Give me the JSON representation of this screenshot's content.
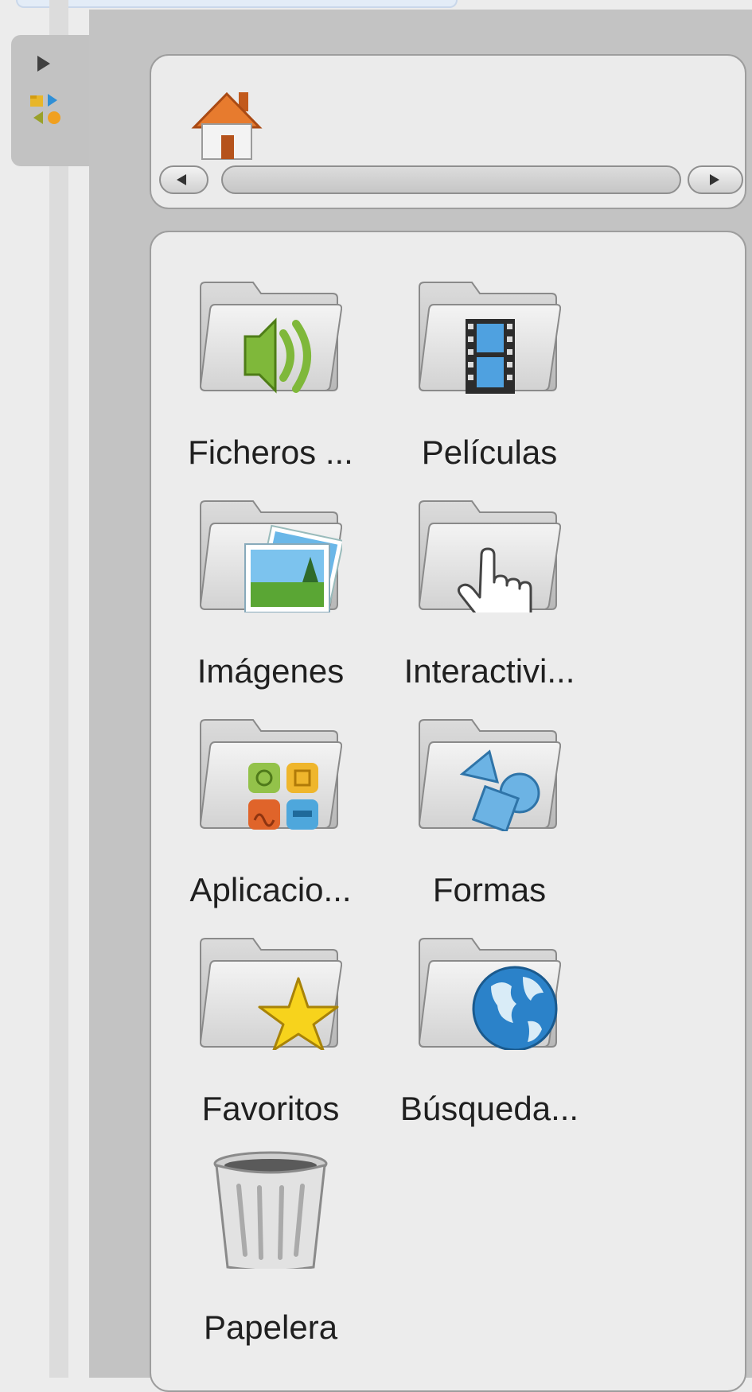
{
  "nav": {
    "home_label": "home"
  },
  "items": [
    {
      "label": "Ficheros ...",
      "icon": "folder-audio-icon"
    },
    {
      "label": "Películas",
      "icon": "folder-film-icon"
    },
    {
      "label": "Imágenes",
      "icon": "folder-images-icon"
    },
    {
      "label": "Interactivi...",
      "icon": "folder-hand-icon"
    },
    {
      "label": "Aplicacio...",
      "icon": "folder-apps-icon"
    },
    {
      "label": "Formas",
      "icon": "folder-shapes-icon"
    },
    {
      "label": "Favoritos",
      "icon": "folder-star-icon"
    },
    {
      "label": "Búsqueda...",
      "icon": "folder-globe-icon"
    },
    {
      "label": "Papelera",
      "icon": "trash-icon"
    }
  ],
  "colors": {
    "panel": "#c3c3c3",
    "box": "#ececec",
    "border": "#9d9d9d"
  }
}
